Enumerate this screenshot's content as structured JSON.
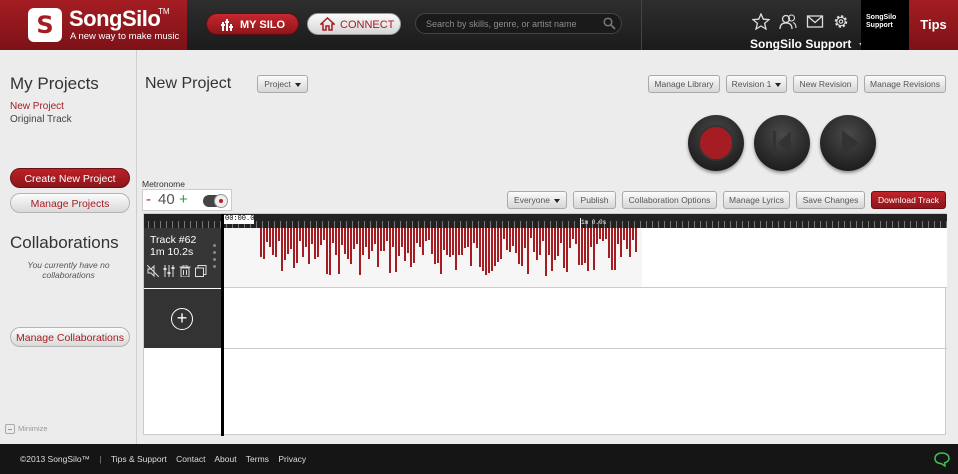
{
  "header": {
    "logo_text": "SongSilo",
    "logo_tm": "TM",
    "tagline": "A new way to make music",
    "my_silo_label": "MY SILO",
    "connect_label": "CONNECT",
    "search_placeholder": "Search by skills, genre, or artist name",
    "user_name": "SongSilo Support",
    "avatar_text": "SongSilo Support",
    "tips_label": "Tips",
    "icons": [
      "star-icon",
      "contacts-icon",
      "mail-icon",
      "gear-icon"
    ]
  },
  "sidebar": {
    "projects_title": "My Projects",
    "projects": [
      {
        "label": "New Project",
        "active": true
      },
      {
        "label": "Original Track",
        "active": false
      }
    ],
    "create_project_label": "Create New Project",
    "manage_projects_label": "Manage Projects",
    "collaborations_title": "Collaborations",
    "collaborations_empty": "You currently have no collaborations",
    "manage_collaborations_label": "Manage Collaborations",
    "minimize_label": "Minimize"
  },
  "main": {
    "title": "New Project",
    "project_dropdown": "Project",
    "manage_library_label": "Manage Library",
    "revision_dropdown": "Revision 1",
    "new_revision_label": "New Revision",
    "manage_revisions_label": "Manage Revisions",
    "transport": [
      "record-button",
      "rewind-button",
      "play-button"
    ],
    "metronome_label": "Metronome",
    "metronome_minus": "-",
    "metronome_value": "40",
    "metronome_plus": "+",
    "toolbar": {
      "visibility_dropdown": "Everyone",
      "publish_label": "Publish",
      "collab_options_label": "Collaboration Options",
      "manage_lyrics_label": "Manage Lyrics",
      "save_changes_label": "Save Changes",
      "download_track_label": "Download Track"
    }
  },
  "timeline": {
    "start_time": "00:00.0",
    "marker_time": "1m 0.0s",
    "tracks": [
      {
        "name": "Track #62",
        "duration": "1m 10.2s"
      }
    ],
    "track_tools": [
      "mute-icon",
      "mixer-icon",
      "trash-icon",
      "copy-icon"
    ]
  },
  "footer": {
    "copyright": "©2013 SongSilo™",
    "separator": "|",
    "links": [
      "Tips & Support",
      "Contact",
      "About",
      "Terms",
      "Privacy"
    ]
  },
  "colors": {
    "brand_red": "#a51d23",
    "header_dark": "#1b1b1b",
    "waveform": "#a51d23",
    "accent_green": "#2e9b3a"
  }
}
